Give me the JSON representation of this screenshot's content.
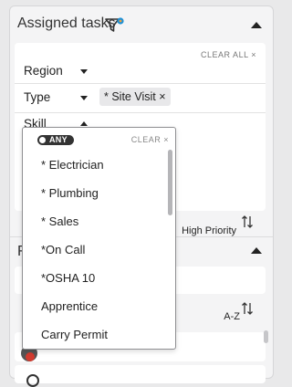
{
  "panel": {
    "title": "Assigned tasks",
    "clear_all": "CLEAR ALL ×"
  },
  "filters": {
    "region_label": "Region",
    "type_label": "Type",
    "type_chip": "* Site Visit ×",
    "skill_label": "Skill"
  },
  "toolbar": {
    "priority_label": "High Priority",
    "sort_label": "A-Z"
  },
  "second_section": {
    "title_partial": "F"
  },
  "skill_dropdown": {
    "toggle_label": "ANY",
    "clear_label": "CLEAR ×",
    "options": [
      "* Electrician",
      "* Plumbing",
      "* Sales",
      "*On Call",
      "*OSHA 10",
      "Apprentice",
      "Carry Permit"
    ]
  },
  "colors": {
    "accent": "#1e90d6",
    "badge": "#f2a13a",
    "avatar_red": "#d23b2f"
  }
}
